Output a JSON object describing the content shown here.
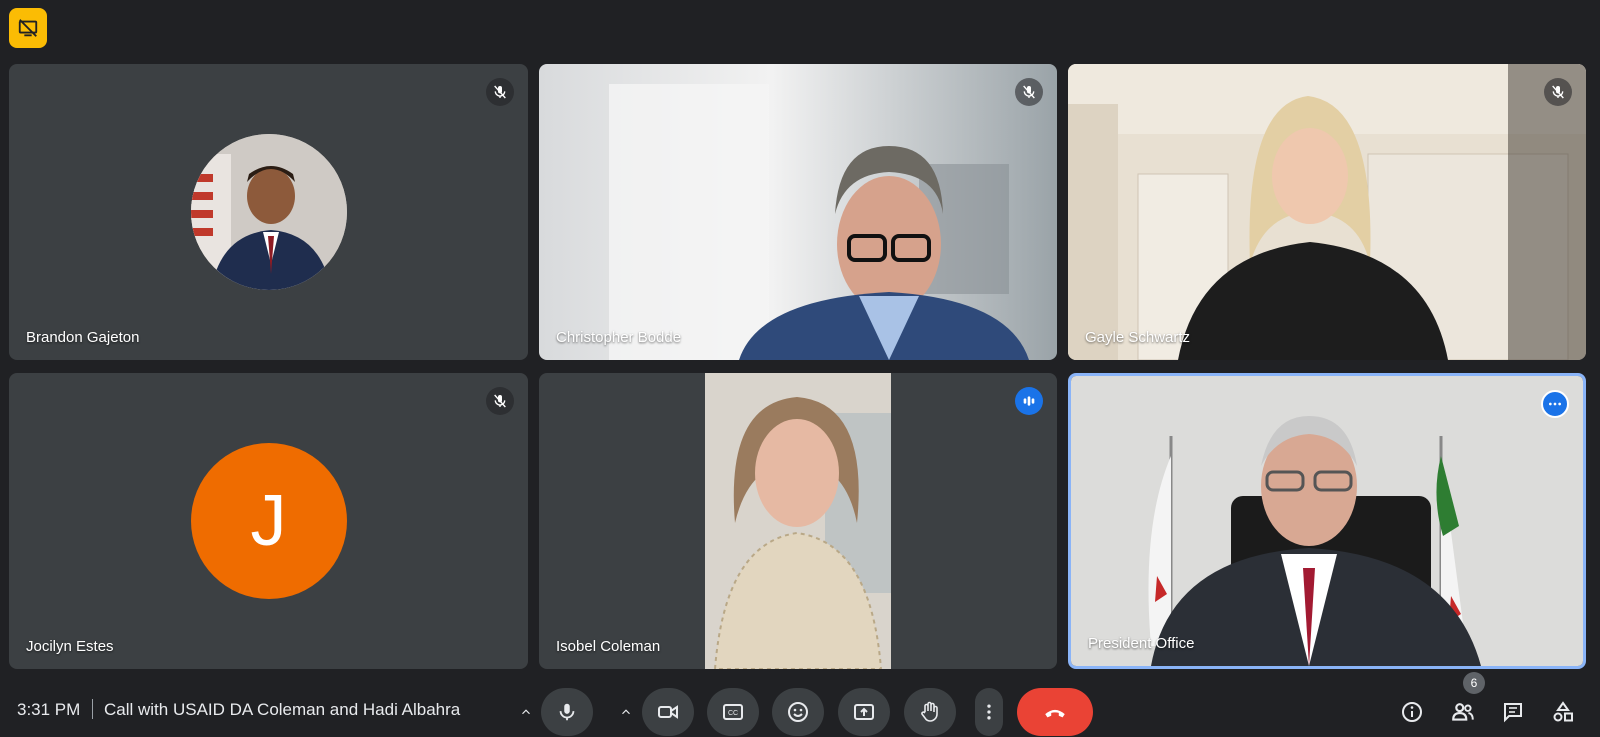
{
  "participants": [
    {
      "name": "Brandon Gajeton"
    },
    {
      "name": "Christopher Bodde"
    },
    {
      "name": "Gayle Schwartz"
    },
    {
      "name": "Jocilyn Estes",
      "initial": "J"
    },
    {
      "name": "Isobel Coleman"
    },
    {
      "name": "President Office"
    }
  ],
  "meeting": {
    "time": "3:31 PM",
    "separator": "|",
    "title": "Call with USAID DA Coleman and Hadi Albahra"
  },
  "people_count": "6",
  "colors": {
    "background": "#202124",
    "tile": "#3c4043",
    "accent": "#1a73e8",
    "end_call": "#ea4335",
    "avatar_orange": "#ef6c00",
    "badge_yellow": "#fbbc04"
  },
  "icons": {
    "top_badge": "screen-share-off-icon",
    "muted": "mic-off-icon",
    "talking": "audio-level-icon",
    "more": "more-horiz-icon"
  }
}
